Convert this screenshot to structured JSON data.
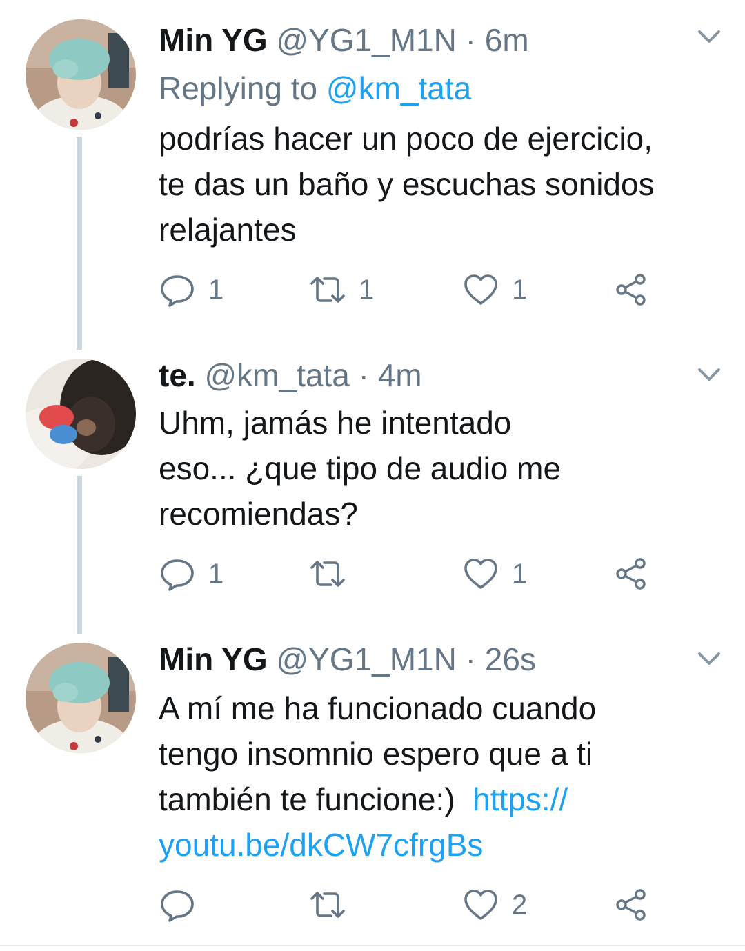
{
  "tweets": [
    {
      "name": "Min YG",
      "handle": "@YG1_M1N",
      "separator": "·",
      "time": "6m",
      "replying_prefix": "Replying to",
      "replying_to": "@km_tata",
      "lines": [
        "podrías hacer un poco de ejercicio,",
        "te das un baño y escuchas sonidos",
        "relajantes"
      ],
      "replies": "1",
      "retweets": "1",
      "likes": "1"
    },
    {
      "name": "te.",
      "handle": "@km_tata",
      "separator": "·",
      "time": "4m",
      "lines": [
        "Uhm, jamás he intentado",
        "eso... ¿que tipo de audio me",
        "recomiendas?"
      ],
      "replies": "1",
      "retweets": "",
      "likes": "1"
    },
    {
      "name": "Min YG",
      "handle": "@YG1_M1N",
      "separator": "·",
      "time": "26s",
      "lines": [
        "A mí me ha funcionado cuando",
        "tengo insomnio espero que a ti",
        "también te funcione:)"
      ],
      "link_part1": "https://",
      "link_part2": "youtu.be/dkCW7cfrgBs",
      "replies": "",
      "retweets": "",
      "likes": "2"
    }
  ],
  "icons": {
    "reply": "reply-icon",
    "retweet": "retweet-icon",
    "like": "heart-icon",
    "share": "share-icon",
    "menu": "chevron-down-icon"
  },
  "colors": {
    "text": "#14171a",
    "secondary": "#657786",
    "link": "#1da1f2",
    "thread_line": "#ccd6dd"
  }
}
